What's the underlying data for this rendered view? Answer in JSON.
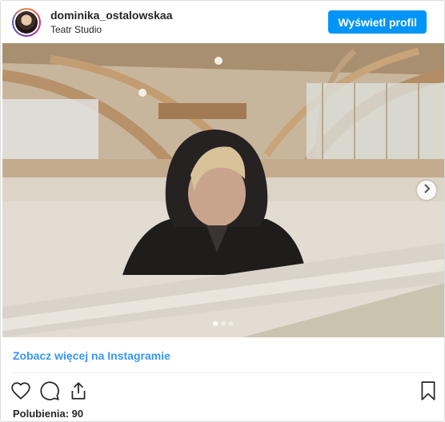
{
  "post": {
    "username": "dominika_ostalowskaa",
    "location": "Teatr Studio",
    "profile_button": "Wyświetl profil",
    "avatar_icon": "profile-avatar",
    "media": {
      "description_icon": "photo-woman-hood-arena",
      "carousel_dots": 3,
      "active_dot": 1,
      "next_icon": "chevron-right-icon"
    },
    "more_link": "Zobacz więcej na Instagramie",
    "actions": {
      "like_icon": "heart-icon",
      "comment_icon": "comment-icon",
      "share_icon": "share-icon",
      "save_icon": "bookmark-icon"
    },
    "likes_text": "Polubienia: 90"
  },
  "colors": {
    "accent": "#0095f6",
    "link": "#3897f0",
    "text": "#262626",
    "border": "#dbdbdb"
  }
}
